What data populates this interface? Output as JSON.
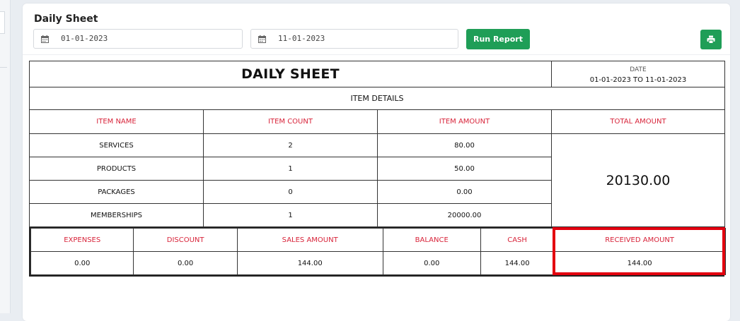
{
  "card": {
    "title": "Daily Sheet",
    "from_date": "01-01-2023",
    "to_date": "11-01-2023",
    "run_label": "Run Report",
    "print_icon": "print-icon",
    "calendar_icon": "calendar-icon"
  },
  "report": {
    "title": "DAILY SHEET",
    "date_label": "DATE",
    "date_range": "01-01-2023 TO 11-01-2023",
    "section_label": "ITEM DETAILS",
    "item_headers": [
      "ITEM NAME",
      "ITEM COUNT",
      "ITEM AMOUNT",
      "TOTAL AMOUNT"
    ],
    "items": [
      {
        "name": "SERVICES",
        "count": "2",
        "amount": "80.00"
      },
      {
        "name": "PRODUCTS",
        "count": "1",
        "amount": "50.00"
      },
      {
        "name": "PACKAGES",
        "count": "0",
        "amount": "0.00"
      },
      {
        "name": "MEMBERSHIPS",
        "count": "1",
        "amount": "20000.00"
      }
    ],
    "total_amount": "20130.00",
    "summary_headers": [
      "EXPENSES",
      "DISCOUNT",
      "SALES AMOUNT",
      "BALANCE",
      "CASH",
      "RECEIVED AMOUNT"
    ],
    "summary_values": [
      "0.00",
      "0.00",
      "144.00",
      "0.00",
      "144.00",
      "144.00"
    ]
  },
  "colors": {
    "accent_green": "#1f9e57",
    "header_red": "#d8243a",
    "highlight_red": "#e3000f"
  }
}
